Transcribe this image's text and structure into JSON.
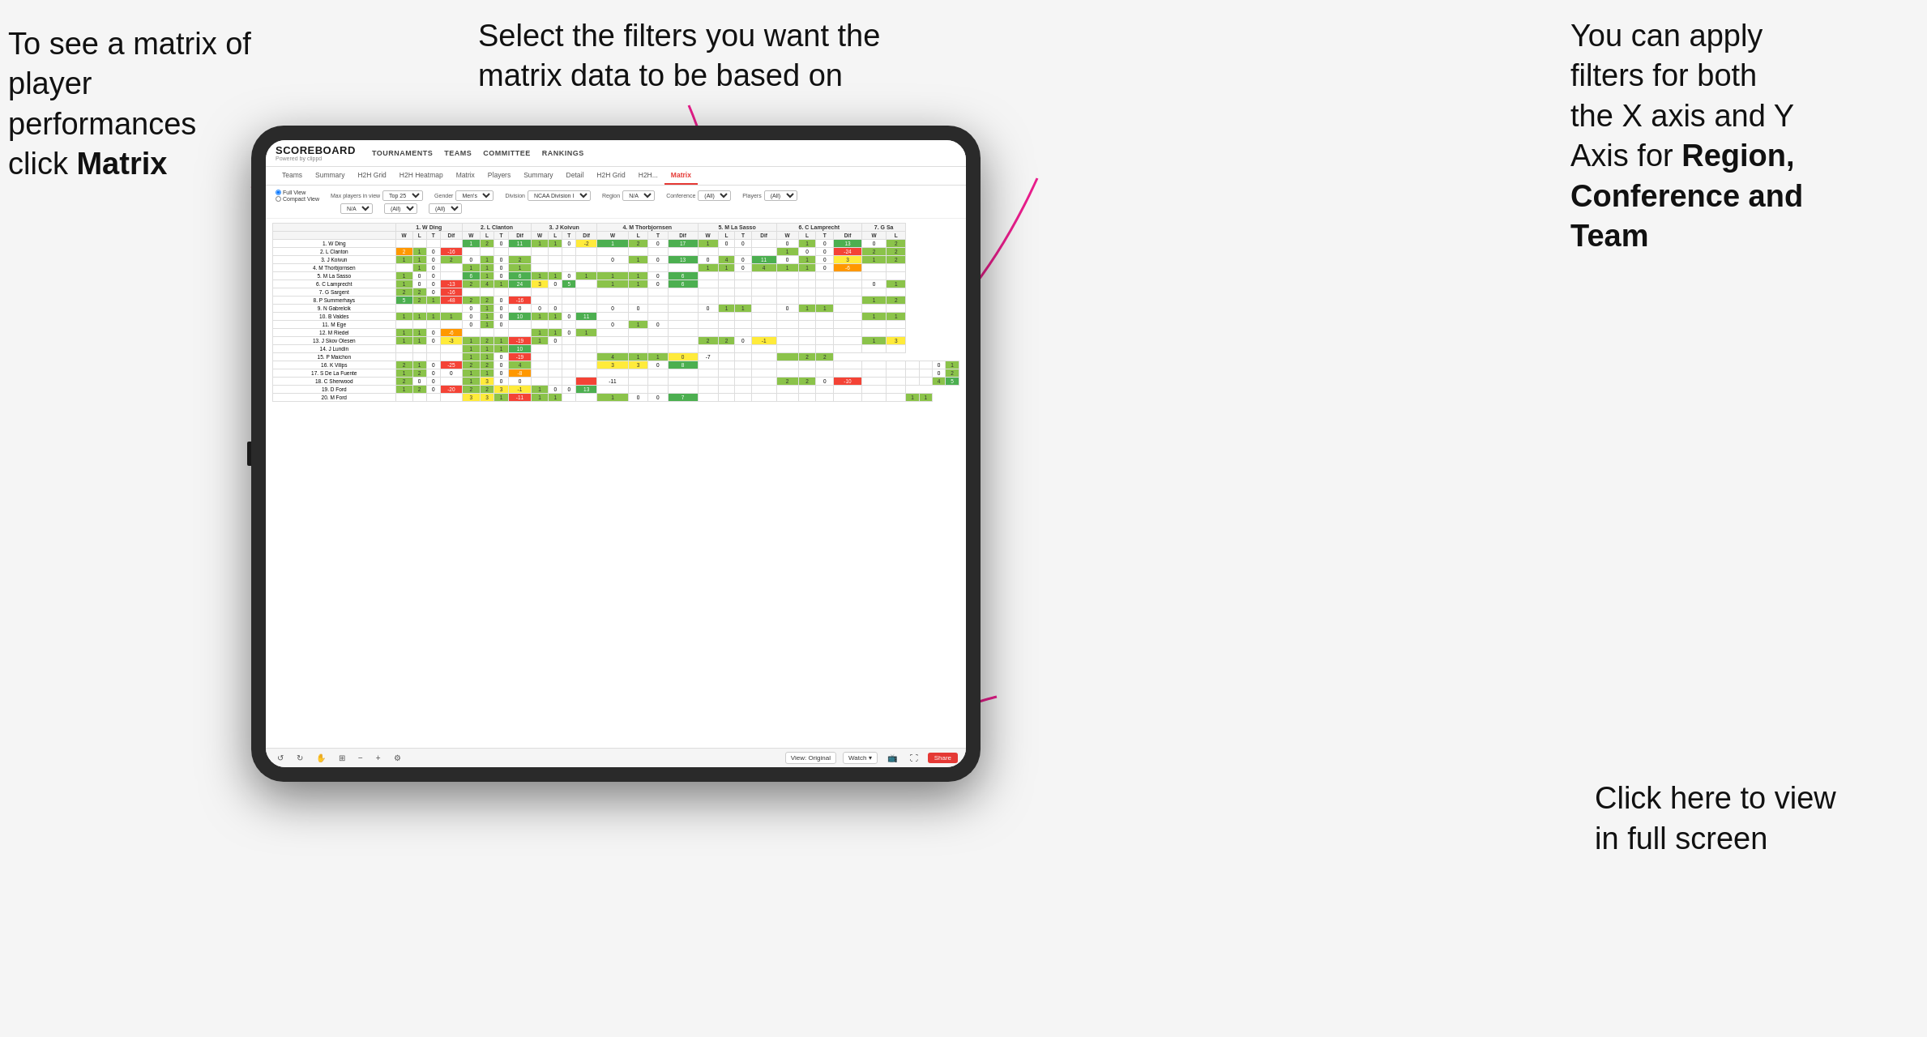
{
  "annotations": {
    "topleft": {
      "line1": "To see a matrix of",
      "line2": "player performances",
      "line3pre": "click ",
      "line3bold": "Matrix"
    },
    "topmid": {
      "text": "Select the filters you want the matrix data to be based on"
    },
    "topright": {
      "line1": "You  can apply",
      "line2": "filters for both",
      "line3": "the X axis and Y",
      "line4pre": "Axis for ",
      "line4bold": "Region,",
      "line5bold": "Conference and",
      "line6bold": "Team"
    },
    "bottomright": {
      "line1": "Click here to view",
      "line2": "in full screen"
    }
  },
  "app": {
    "logo": "SCOREBOARD",
    "logo_sub": "Powered by clippd",
    "nav_items": [
      "TOURNAMENTS",
      "TEAMS",
      "COMMITTEE",
      "RANKINGS"
    ],
    "sub_tabs": [
      "Teams",
      "Summary",
      "H2H Grid",
      "H2H Heatmap",
      "Matrix",
      "Players",
      "Summary",
      "Detail",
      "H2H Grid",
      "H2H...",
      "Matrix"
    ],
    "active_tab": "Matrix",
    "filters": {
      "view_options": [
        "Full View",
        "Compact View"
      ],
      "max_players": "Top 25",
      "gender": "Men's",
      "division": "NCAA Division I",
      "region_label": "Region",
      "region_val": "N/A",
      "conference_label": "Conference",
      "conference_val": "(All)",
      "players_label": "Players",
      "players_val": "(All)"
    },
    "toolbar": {
      "view_label": "View: Original",
      "watch_label": "Watch ▾",
      "share_label": "Share"
    }
  },
  "matrix": {
    "columns": [
      "1. W Ding",
      "2. L Clanton",
      "3. J Koivun",
      "4. M Thorbjornsen",
      "5. M La Sasso",
      "6. C Lamprecht",
      "7. G Sa"
    ],
    "col_sub": [
      "W",
      "L",
      "T",
      "Dif"
    ],
    "rows": [
      {
        "name": "1. W Ding",
        "data": [
          "",
          "",
          "",
          "",
          "1",
          "2",
          "0",
          "11",
          "1",
          "1",
          "0",
          "-2",
          "1",
          "2",
          "0",
          "17",
          "1",
          "0",
          "0",
          "",
          "0",
          "1",
          "0",
          "13",
          "0",
          "2"
        ]
      },
      {
        "name": "2. L Clanton",
        "data": [
          "2",
          "1",
          "0",
          "-16",
          "",
          "",
          "",
          "",
          "",
          "",
          "",
          "",
          "",
          "",
          "",
          "",
          "",
          "",
          "",
          "",
          "1",
          "0",
          "0",
          "-24",
          "2",
          "2"
        ]
      },
      {
        "name": "3. J Koivun",
        "data": [
          "1",
          "1",
          "0",
          "2",
          "0",
          "1",
          "0",
          "2",
          "",
          "",
          "",
          "",
          "0",
          "1",
          "0",
          "13",
          "0",
          "4",
          "0",
          "11",
          "0",
          "1",
          "0",
          "3",
          "1",
          "2"
        ]
      },
      {
        "name": "4. M Thorbjornsen",
        "data": [
          "",
          "1",
          "0",
          "",
          "1",
          "1",
          "0",
          "1",
          "",
          "",
          "",
          "",
          "",
          "",
          "",
          "",
          "1",
          "1",
          "0",
          "4",
          "1",
          "1",
          "0",
          "-6",
          "",
          ""
        ]
      },
      {
        "name": "5. M La Sasso",
        "data": [
          "1",
          "0",
          "0",
          "",
          "6",
          "1",
          "0",
          "6",
          "1",
          "1",
          "0",
          "1",
          "1",
          "1",
          "0",
          "6",
          "",
          "",
          "",
          "",
          "",
          "",
          "",
          "",
          "",
          ""
        ]
      },
      {
        "name": "6. C Lamprecht",
        "data": [
          "1",
          "0",
          "0",
          "-13",
          "2",
          "4",
          "1",
          "24",
          "3",
          "0",
          "5",
          "",
          "1",
          "1",
          "0",
          "6",
          "",
          "",
          "",
          "",
          "",
          "",
          "",
          "",
          "0",
          "1"
        ]
      },
      {
        "name": "7. G Sargent",
        "data": [
          "2",
          "2",
          "0",
          "-16",
          "",
          "",
          "",
          "",
          "",
          "",
          "",
          "",
          "",
          "",
          "",
          "",
          "",
          "",
          "",
          "",
          "",
          "",
          "",
          "",
          "",
          ""
        ]
      },
      {
        "name": "8. P Summerhays",
        "data": [
          "5",
          "2",
          "1",
          "-48",
          "2",
          "2",
          "0",
          "-16",
          "",
          "",
          "",
          "",
          "",
          "",
          "",
          "",
          "",
          "",
          "",
          "",
          "",
          "",
          "",
          "",
          "1",
          "2"
        ]
      },
      {
        "name": "9. N Gabrelcik",
        "data": [
          "",
          "",
          "",
          "",
          "0",
          "1",
          "0",
          "0",
          "0",
          "0",
          "",
          "",
          "0",
          "0",
          "",
          "",
          "0",
          "1",
          "1",
          "",
          "0",
          "1",
          "1",
          "",
          "",
          ""
        ]
      },
      {
        "name": "10. B Valdes",
        "data": [
          "1",
          "1",
          "1",
          "1",
          "0",
          "1",
          "0",
          "10",
          "1",
          "1",
          "0",
          "11",
          "",
          "",
          "",
          "",
          "",
          "",
          "",
          "",
          "",
          "",
          "",
          "",
          "1",
          "1"
        ]
      },
      {
        "name": "11. M Ege",
        "data": [
          "",
          "",
          "",
          "",
          "0",
          "1",
          "0",
          "",
          "",
          "",
          "",
          "",
          "0",
          "1",
          "0",
          "",
          "",
          "",
          "",
          "",
          "",
          "",
          "",
          "",
          "",
          ""
        ]
      },
      {
        "name": "12. M Riedel",
        "data": [
          "1",
          "1",
          "0",
          "-6",
          "",
          "",
          "",
          "",
          "1",
          "1",
          "0",
          "1",
          "",
          "",
          "",
          "",
          "",
          "",
          "",
          "",
          "",
          "",
          "",
          "",
          "",
          ""
        ]
      },
      {
        "name": "13. J Skov Olesen",
        "data": [
          "1",
          "1",
          "0",
          "-3",
          "1",
          "2",
          "1",
          "-19",
          "1",
          "0",
          "",
          "",
          "",
          "",
          "",
          "",
          "2",
          "2",
          "0",
          "-1",
          "",
          "",
          "",
          "",
          "1",
          "3"
        ]
      },
      {
        "name": "14. J Lundin",
        "data": [
          "",
          "",
          "",
          "",
          "1",
          "1",
          "1",
          "10",
          "",
          "",
          "",
          "",
          "",
          "",
          "",
          "",
          "",
          "",
          "",
          "",
          "",
          "",
          "",
          "",
          "",
          ""
        ]
      },
      {
        "name": "15. P Maichon",
        "data": [
          "",
          "",
          "",
          "",
          "1",
          "1",
          "0",
          "-19",
          "",
          "",
          "",
          "",
          "4",
          "1",
          "1",
          "0",
          "-7",
          "",
          "",
          "",
          "",
          "2",
          "2"
        ]
      },
      {
        "name": "16. K Vilips",
        "data": [
          "2",
          "1",
          "0",
          "-25",
          "2",
          "2",
          "0",
          "4",
          "",
          "",
          "",
          "",
          "3",
          "3",
          "0",
          "8",
          "",
          "",
          "",
          "",
          "",
          "",
          "",
          "",
          "",
          "",
          "",
          "",
          "0",
          "1"
        ]
      },
      {
        "name": "17. S De La Fuente",
        "data": [
          "1",
          "2",
          "0",
          "0",
          "1",
          "1",
          "0",
          "-8",
          "",
          "",
          "",
          "",
          "",
          "",
          "",
          "",
          "",
          "",
          "",
          "",
          "",
          "",
          "",
          "",
          "",
          "",
          "",
          "",
          "0",
          "2"
        ]
      },
      {
        "name": "18. C Sherwood",
        "data": [
          "2",
          "0",
          "0",
          "",
          "1",
          "3",
          "0",
          "0",
          "",
          "",
          "",
          "",
          "-11",
          "",
          "",
          "",
          "",
          "",
          "",
          "",
          "2",
          "2",
          "0",
          "-10",
          "",
          "",
          "",
          "",
          "4",
          "5"
        ]
      },
      {
        "name": "19. D Ford",
        "data": [
          "1",
          "2",
          "0",
          "-20",
          "2",
          "2",
          "3",
          "-1",
          "1",
          "0",
          "0",
          "13",
          "",
          "",
          "",
          "",
          "",
          "",
          "",
          "",
          "",
          "",
          "",
          "",
          "",
          ""
        ]
      },
      {
        "name": "20. M Ford",
        "data": [
          "",
          "",
          "",
          "",
          "3",
          "3",
          "1",
          "-11",
          "1",
          "1",
          "",
          "",
          "1",
          "0",
          "0",
          "7",
          "",
          "",
          "",
          "",
          "",
          "",
          "",
          "",
          "",
          "",
          "1",
          "1"
        ]
      }
    ]
  }
}
